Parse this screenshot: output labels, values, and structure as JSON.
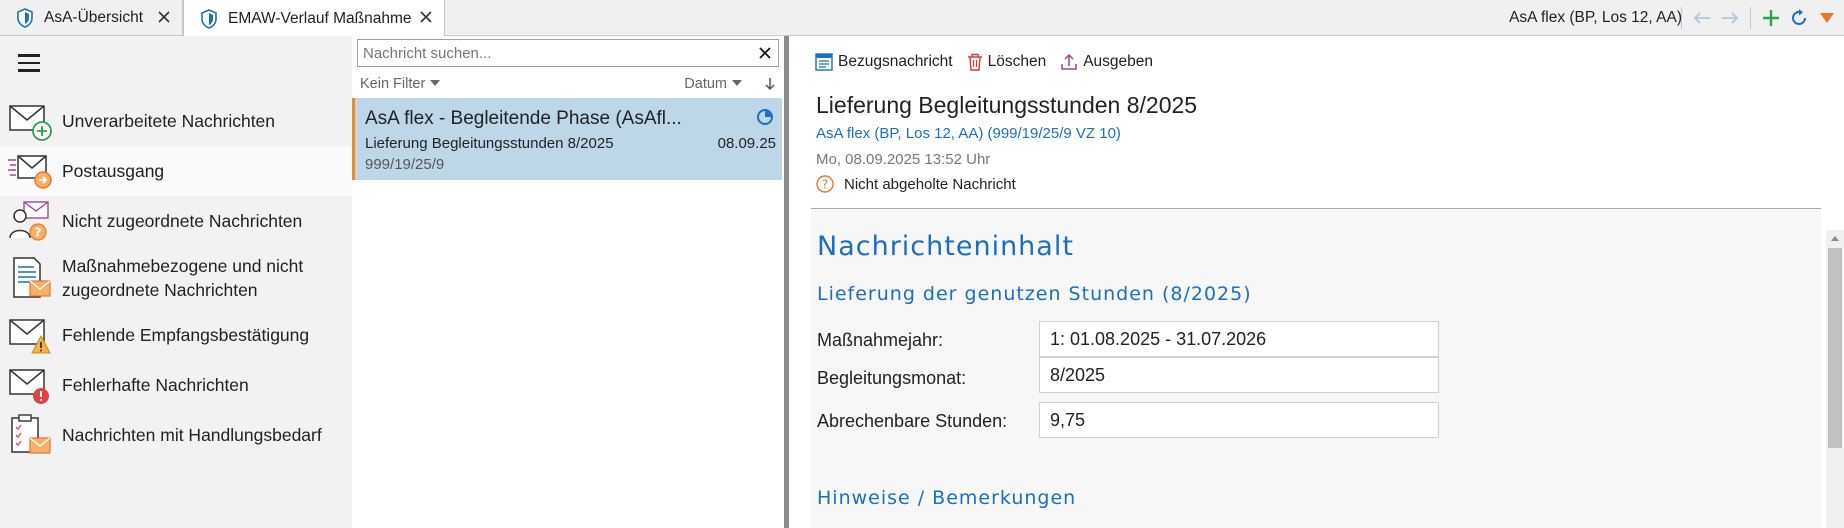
{
  "tabs": [
    {
      "label": "AsA-Übersicht"
    },
    {
      "label": "EMAW-Verlauf Maßnahme"
    }
  ],
  "header": {
    "context": "AsA flex (BP, Los 12, AA)"
  },
  "sidebar": {
    "items": [
      {
        "label": "Unverarbeitete Nachrichten"
      },
      {
        "label": "Postausgang"
      },
      {
        "label": "Nicht zugeordnete Nachrichten"
      },
      {
        "label": "Maßnahmebezogene und nicht zugeordnete Nachrichten"
      },
      {
        "label": "Fehlende Empfangsbestätigung"
      },
      {
        "label": "Fehlerhafte Nachrichten"
      },
      {
        "label": "Nachrichten mit Handlungsbedarf"
      }
    ],
    "selected": "Postausgang"
  },
  "list": {
    "search_placeholder": "Nachricht suchen...",
    "filter_label": "Kein Filter",
    "sort_label": "Datum",
    "messages": [
      {
        "title": "AsA flex - Begleitende Phase (AsAfl...",
        "subject": "Lieferung Begleitungsstunden 8/2025",
        "date": "08.09.25",
        "ref": "999/19/25/9"
      }
    ]
  },
  "detail": {
    "toolbar": {
      "reference": "Bezugsnachricht",
      "delete": "Löschen",
      "export": "Ausgeben"
    },
    "title": "Lieferung Begleitungsstunden 8/2025",
    "link": "AsA flex (BP, Los 12, AA) (999/19/25/9 VZ 10)",
    "timestamp": "Mo, 08.09.2025 13:52 Uhr",
    "status": "Nicht abgeholte Nachricht",
    "content": {
      "heading": "Nachrichteninhalt",
      "section1": "Lieferung der genutzen Stunden (8/2025)",
      "fields": [
        {
          "label": "Maßnahmejahr:",
          "value": "1: 01.08.2025 - 31.07.2026"
        },
        {
          "label": "Begleitungsmonat:",
          "value": "8/2025"
        },
        {
          "label": "Abrechenbare Stunden:",
          "value": "9,75"
        }
      ],
      "section2": "Hinweise / Bemerkungen"
    }
  },
  "colors": {
    "accent_blue": "#1a6fc1",
    "selection": "#bdd7e9",
    "orange": "#f08a24"
  }
}
